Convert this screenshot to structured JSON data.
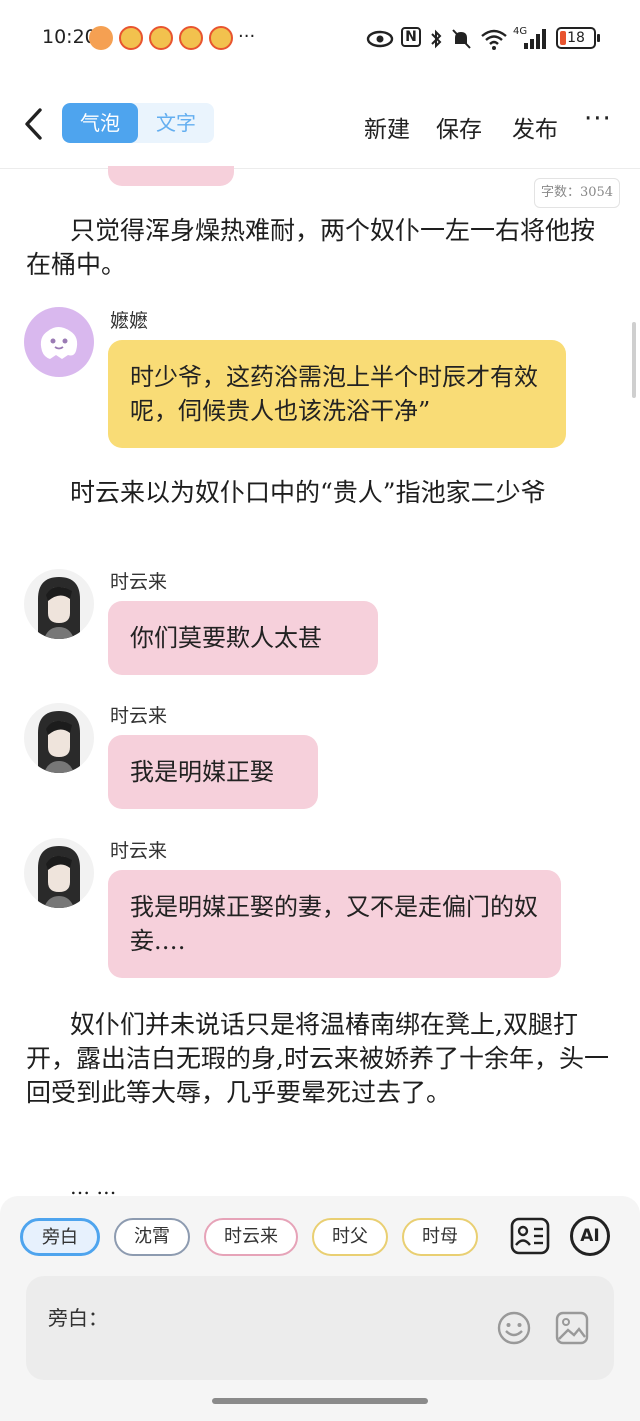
{
  "status_bar": {
    "time": "10:20",
    "more": "···",
    "nfc_label": "N",
    "network": "4G",
    "battery": "18"
  },
  "nav": {
    "tabs": [
      {
        "label": "气泡",
        "active": true
      },
      {
        "label": "文字",
        "active": false
      }
    ],
    "new_label": "新建",
    "save_label": "保存",
    "publish_label": "发布",
    "more_label": "···"
  },
  "word_count": "字数：3054",
  "content": [
    {
      "type": "narration",
      "text": "只觉得浑身燥热难耐，两个奴仆一左一右将他按在桶中。"
    },
    {
      "type": "bubble",
      "speaker": "嬷嬷",
      "color": "#f9dc76",
      "text": "时少爷，这药浴需泡上半个时辰才有效呢，伺候贵人也该洗浴干净”"
    },
    {
      "type": "narration",
      "text": "时云来以为奴仆口中的“贵人”指池家二少爷"
    },
    {
      "type": "bubble",
      "speaker": "时云来",
      "color": "#f6d0db",
      "text": "你们莫要欺人太甚"
    },
    {
      "type": "bubble",
      "speaker": "时云来",
      "color": "#f6d0db",
      "text": "我是明媒正娶"
    },
    {
      "type": "bubble",
      "speaker": "时云来",
      "color": "#f6d0db",
      "text": "我是明媒正娶的妻，又不是走偏门的奴妾.…"
    },
    {
      "type": "narration",
      "text": "奴仆们并未说话只是将温椿南绑在凳上,双腿打开，露出洁白无瑕的身,时云来被娇养了十余年，头一回受到此等大辱，几乎要晕死过去了。"
    },
    {
      "type": "narration",
      "text": "… …"
    }
  ],
  "roles": [
    {
      "label": "旁白",
      "border": "#4ea4ee",
      "selected": true
    },
    {
      "label": "沈霄",
      "border": "#8d9bb0",
      "selected": false
    },
    {
      "label": "时云来",
      "border": "#e6a3b8",
      "selected": false
    },
    {
      "label": "时父",
      "border": "#e9cf72",
      "selected": false
    },
    {
      "label": "时母",
      "border": "#e9cf72",
      "selected": false
    }
  ],
  "ai_label": "AI",
  "input": {
    "label": "旁白："
  }
}
